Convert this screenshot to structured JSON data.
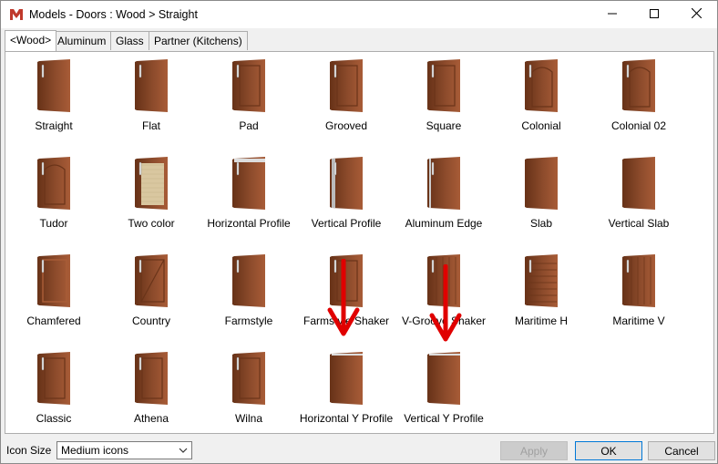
{
  "window": {
    "title": "Models - Doors : Wood > Straight",
    "accent": "#c0392b"
  },
  "tabs": [
    {
      "label": "<Wood>",
      "active": true
    },
    {
      "label": "Aluminum",
      "active": false
    },
    {
      "label": "Glass",
      "active": false
    },
    {
      "label": "Partner (Kitchens)",
      "active": false
    }
  ],
  "models": [
    {
      "label": "Straight",
      "style": "straight"
    },
    {
      "label": "Flat",
      "style": "flat"
    },
    {
      "label": "Pad",
      "style": "pad"
    },
    {
      "label": "Grooved",
      "style": "grooved"
    },
    {
      "label": "Square",
      "style": "square"
    },
    {
      "label": "Colonial",
      "style": "colonial"
    },
    {
      "label": "Colonial 02",
      "style": "colonial"
    },
    {
      "label": "Tudor",
      "style": "tudor"
    },
    {
      "label": "Two color",
      "style": "twocolor"
    },
    {
      "label": "Horizontal Profile",
      "style": "hprofile"
    },
    {
      "label": "Vertical Profile",
      "style": "vprofile"
    },
    {
      "label": "Aluminum Edge",
      "style": "aledge"
    },
    {
      "label": "Slab",
      "style": "slab"
    },
    {
      "label": "Vertical Slab",
      "style": "slab"
    },
    {
      "label": "Chamfered",
      "style": "chamfered"
    },
    {
      "label": "Country",
      "style": "country"
    },
    {
      "label": "Farmstyle",
      "style": "farm"
    },
    {
      "label": "Farmstyle Shaker",
      "style": "shaker"
    },
    {
      "label": "V-Groove Shaker",
      "style": "vgroove"
    },
    {
      "label": "Maritime H",
      "style": "maritimeh"
    },
    {
      "label": "Maritime V",
      "style": "maritimev"
    },
    {
      "label": "Classic",
      "style": "classic"
    },
    {
      "label": "Athena",
      "style": "athena"
    },
    {
      "label": "Wilna",
      "style": "wilna"
    },
    {
      "label": "Horizontal Y Profile",
      "style": "yprofile"
    },
    {
      "label": "Vertical Y Profile",
      "style": "yprofile"
    }
  ],
  "annotation_color": "#e00000",
  "footer": {
    "icon_size_label": "Icon Size",
    "icon_size_value": "Medium icons",
    "apply_label": "Apply",
    "ok_label": "OK",
    "cancel_label": "Cancel"
  },
  "colors": {
    "wood": "#8b4a2b",
    "wood_dark": "#6a3419",
    "wood_light": "#a85c37"
  }
}
